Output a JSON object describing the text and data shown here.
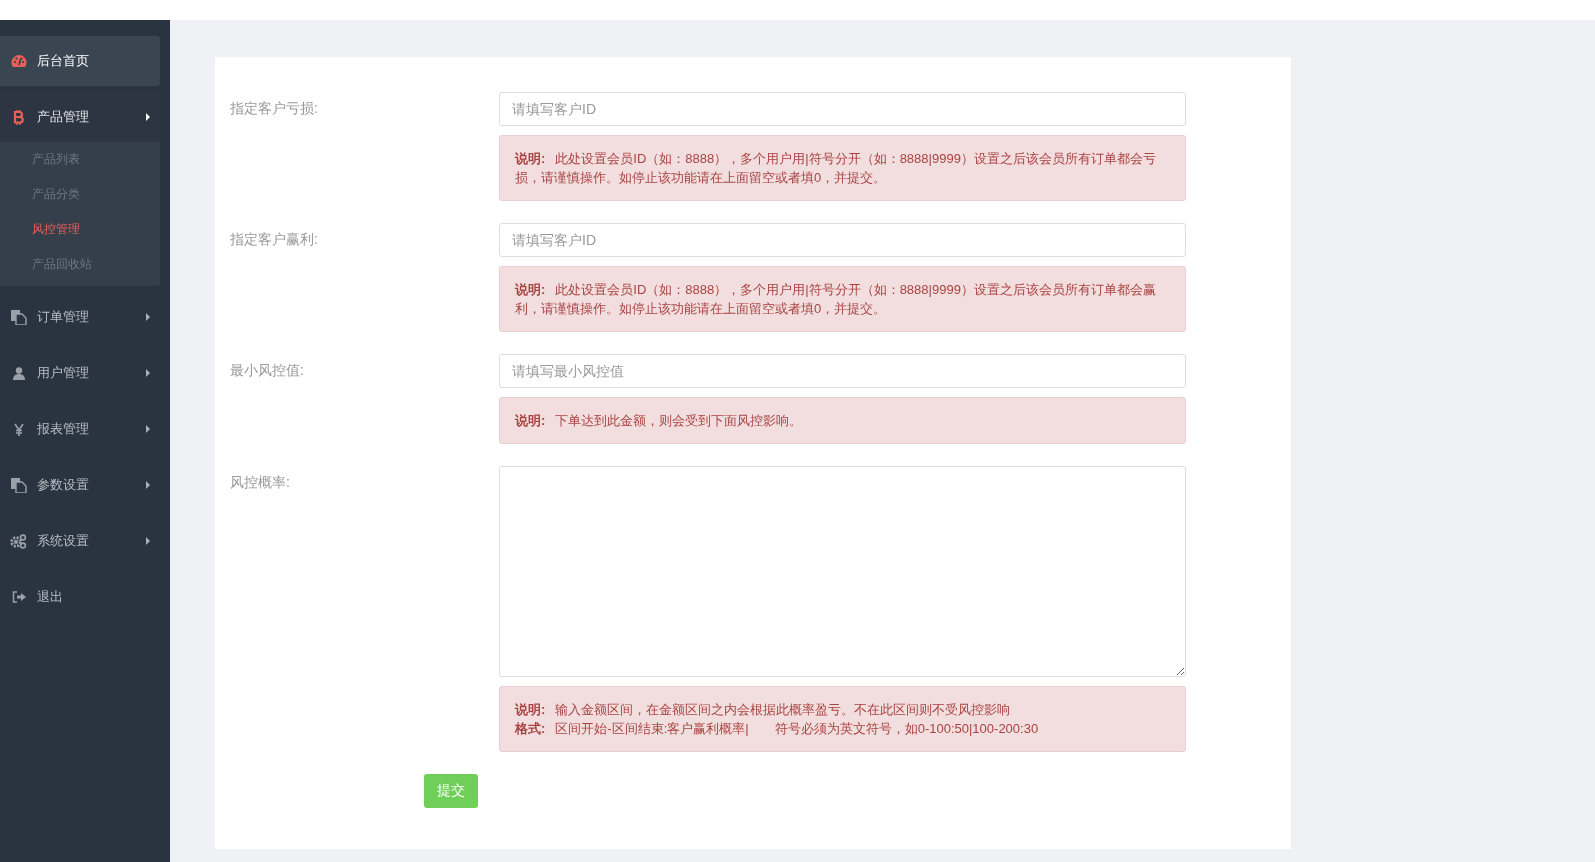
{
  "sidebar": {
    "items": [
      {
        "label": "后台首页",
        "arrow": false,
        "expanded": false,
        "selected": true
      },
      {
        "label": "产品管理",
        "arrow": true,
        "expanded": true,
        "selected": false,
        "children": [
          {
            "label": "产品列表",
            "selected": false
          },
          {
            "label": "产品分类",
            "selected": false
          },
          {
            "label": "风控管理",
            "selected": true
          },
          {
            "label": "产品回收站",
            "selected": false
          }
        ]
      },
      {
        "label": "订单管理",
        "arrow": true,
        "expanded": false,
        "selected": false
      },
      {
        "label": "用户管理",
        "arrow": true,
        "expanded": false,
        "selected": false
      },
      {
        "label": "报表管理",
        "arrow": true,
        "expanded": false,
        "selected": false
      },
      {
        "label": "参数设置",
        "arrow": true,
        "expanded": false,
        "selected": false
      },
      {
        "label": "系统设置",
        "arrow": true,
        "expanded": false,
        "selected": false
      },
      {
        "label": "退出",
        "arrow": false,
        "expanded": false,
        "selected": false
      }
    ]
  },
  "form": {
    "fields": [
      {
        "kind": "input",
        "label": "指定客户亏损:",
        "placeholder": "请填写客户ID",
        "notes": [
          {
            "label": "说明:",
            "text": "此处设置会员ID（如：8888），多个用户用|符号分开（如：8888|9999）设置之后该会员所有订单都会亏损，请谨慎操作。如停止该功能请在上面留空或者填0，并提交。"
          }
        ]
      },
      {
        "kind": "input",
        "label": "指定客户赢利:",
        "placeholder": "请填写客户ID",
        "notes": [
          {
            "label": "说明:",
            "text": "此处设置会员ID（如：8888），多个用户用|符号分开（如：8888|9999）设置之后该会员所有订单都会赢利，请谨慎操作。如停止该功能请在上面留空或者填0，并提交。"
          }
        ]
      },
      {
        "kind": "input",
        "label": "最小风控值:",
        "placeholder": "请填写最小风控值",
        "notes": [
          {
            "label": "说明:",
            "text": "下单达到此金额，则会受到下面风控影响。"
          }
        ]
      },
      {
        "kind": "textarea",
        "label": "风控概率:",
        "notes": [
          {
            "label": "说明:",
            "text": "输入金额区间，在金额区间之内会根据此概率盈亏。不在此区间则不受风控影响"
          },
          {
            "label": "格式:",
            "text": "区间开始-区间结束:客户赢利概率|　　符号必须为英文符号，如0-100:50|100-200:30"
          }
        ]
      }
    ],
    "submit": "提交"
  }
}
